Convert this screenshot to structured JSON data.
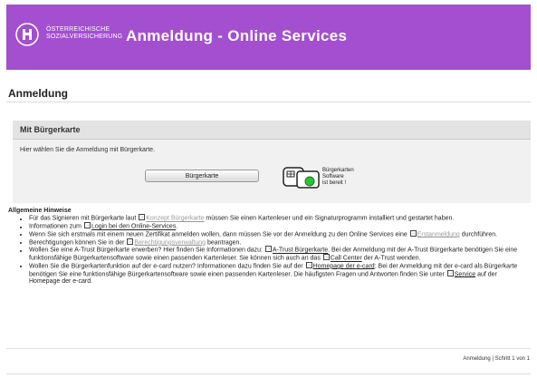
{
  "header": {
    "org_line1": "ÖSTERREICHISCHE",
    "org_line2": "SOZIALVERSICHERUNG",
    "title": "Anmeldung - Online Services",
    "brand_color": "#a34fcf"
  },
  "page": {
    "title": "Anmeldung"
  },
  "panel": {
    "heading": "Mit Bürgerkarte",
    "text": "Hier wählen Sie die Anmeldung mit Bürgerkarte.",
    "button_label": "Bürgerkarte",
    "status_line1": "Bürgerkarten",
    "status_line2": "Software",
    "status_line3": "ist bereit !",
    "status_icon": "smartcard-reader-icon"
  },
  "notes": {
    "heading": "Allgemeine Hinweise",
    "n1": {
      "pre": "Für das Signieren mit Bürgerkarte laut",
      "link": "Konzept Bürgerkarte",
      "post": "müssen Sie einen Kartenleser und ein Signaturprogramm installiert und gestartet haben."
    },
    "n2": {
      "pre": "Informationen zum",
      "link": "Login bei den Online-Services",
      "post": "."
    },
    "n3": {
      "pre": "Wenn Sie sich erstmals mit einem neuen Zertifikat anmelden wollen, dann müssen Sie vor der Anmeldung zu den Online Services eine",
      "link": "Erstanmeldung",
      "post": "durchführen."
    },
    "n4": {
      "pre": "Berechtigungen können Sie in der",
      "link": "Berechtigungsverwaltung",
      "post": "beantragen."
    },
    "n5": {
      "pre": "Wollen Sie eine A-Trust Bürgerkarte erwerben? Hier finden Sie Informationen dazu:",
      "link1": "A-Trust Bürgerkarte",
      "mid": ". Bei der Anmeldung mit der A-Trust Bürgerkarte benötigen Sie eine funktionsfähige Bürgerkartensoftware sowie einen passenden Kartenleser. Sie können sich auch an das",
      "link2": "Call Center",
      "post": "der A-Trust wenden."
    },
    "n6": {
      "pre": "Wollen Sie die Bürgerkartenfunktion auf der e-card nutzen? Informationen dazu finden Sie auf der",
      "link1": "Homepage der e-card",
      "mid": ": Bei der Anmeldung mit der e-card als Bürgerkarte benötigen Sie eine funktionsfähige Bürgerkartensoftware sowie einen passenden Kartenleser. Die häufigsten Fragen und Antworten finden Sie unter",
      "link2": "Service",
      "post": "auf der Homepage der e-card."
    }
  },
  "footer": {
    "status": "Anmeldung | Schritt 1 von 1"
  }
}
